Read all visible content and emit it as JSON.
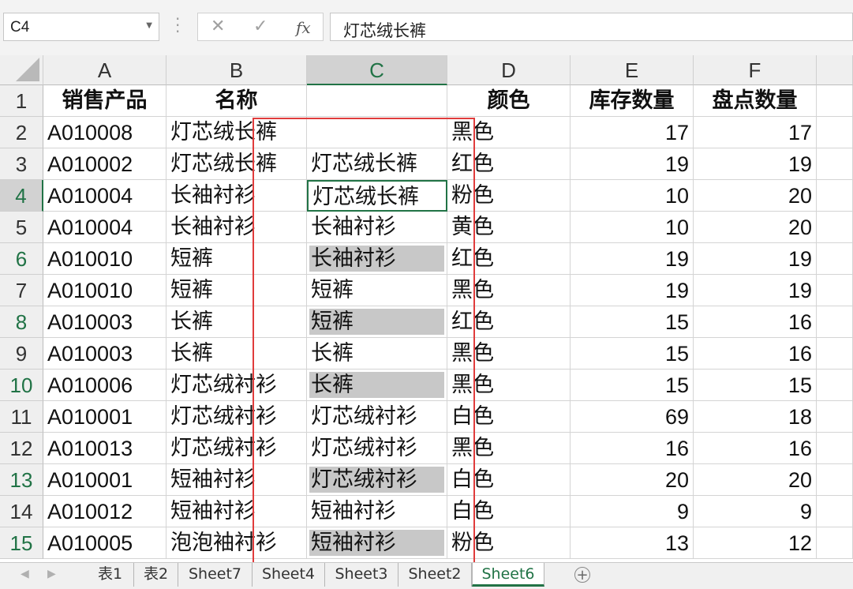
{
  "formula_bar": {
    "name_box": "C4",
    "cancel_icon": "✕",
    "enter_icon": "✓",
    "fx_label": "fx",
    "formula": "灯芯绒长裤"
  },
  "columns": [
    "A",
    "B",
    "C",
    "D",
    "E",
    "F"
  ],
  "selected_column": "C",
  "rows": [
    {
      "n": "1",
      "a": "销售产品",
      "b": "名称",
      "c": "",
      "d": "颜色",
      "e": "库存数量",
      "f": "盘点数量"
    },
    {
      "n": "2",
      "a": "A010008",
      "b": "灯芯绒长裤",
      "c": "",
      "d": "黑色",
      "e": "17",
      "f": "17"
    },
    {
      "n": "3",
      "a": "A010002",
      "b": "灯芯绒长裤",
      "c": "灯芯绒长裤",
      "d": "红色",
      "e": "19",
      "f": "19"
    },
    {
      "n": "4",
      "a": "A010004",
      "b": "长袖衬衫",
      "c": "灯芯绒长裤",
      "d": "粉色",
      "e": "10",
      "f": "20"
    },
    {
      "n": "5",
      "a": "A010004",
      "b": "长袖衬衫",
      "c": "长袖衬衫",
      "d": "黄色",
      "e": "10",
      "f": "20"
    },
    {
      "n": "6",
      "a": "A010010",
      "b": "短裤",
      "c": "长袖衬衫",
      "d": "红色",
      "e": "19",
      "f": "19"
    },
    {
      "n": "7",
      "a": "A010010",
      "b": "短裤",
      "c": "短裤",
      "d": "黑色",
      "e": "19",
      "f": "19"
    },
    {
      "n": "8",
      "a": "A010003",
      "b": "长裤",
      "c": "短裤",
      "d": "红色",
      "e": "15",
      "f": "16"
    },
    {
      "n": "9",
      "a": "A010003",
      "b": "长裤",
      "c": "长裤",
      "d": "黑色",
      "e": "15",
      "f": "16"
    },
    {
      "n": "10",
      "a": "A010006",
      "b": "灯芯绒衬衫",
      "c": "长裤",
      "d": "黑色",
      "e": "15",
      "f": "15"
    },
    {
      "n": "11",
      "a": "A010001",
      "b": "灯芯绒衬衫",
      "c": "灯芯绒衬衫",
      "d": "白色",
      "e": "69",
      "f": "18"
    },
    {
      "n": "12",
      "a": "A010013",
      "b": "灯芯绒衬衫",
      "c": "灯芯绒衬衫",
      "d": "黑色",
      "e": "16",
      "f": "16"
    },
    {
      "n": "13",
      "a": "A010001",
      "b": "短袖衬衫",
      "c": "灯芯绒衬衫",
      "d": "白色",
      "e": "20",
      "f": "20"
    },
    {
      "n": "14",
      "a": "A010012",
      "b": "短袖衬衫",
      "c": "短袖衬衫",
      "d": "白色",
      "e": "9",
      "f": "9"
    },
    {
      "n": "15",
      "a": "A010005",
      "b": "泡泡袖衬衫",
      "c": "短袖衬衫",
      "d": "粉色",
      "e": "13",
      "f": "12"
    }
  ],
  "highlighted_c_rows": [
    "6",
    "8",
    "10",
    "13",
    "15"
  ],
  "active_cell": "C4",
  "sheet_tabs": [
    "表1",
    "表2",
    "Sheet7",
    "Sheet4",
    "Sheet3",
    "Sheet2",
    "Sheet6"
  ],
  "active_sheet": "Sheet6",
  "add_sheet_icon": "+",
  "colors": {
    "accent": "#217346",
    "highlight_box": "#e03c3c",
    "filled_cell": "#c8c8c8"
  }
}
